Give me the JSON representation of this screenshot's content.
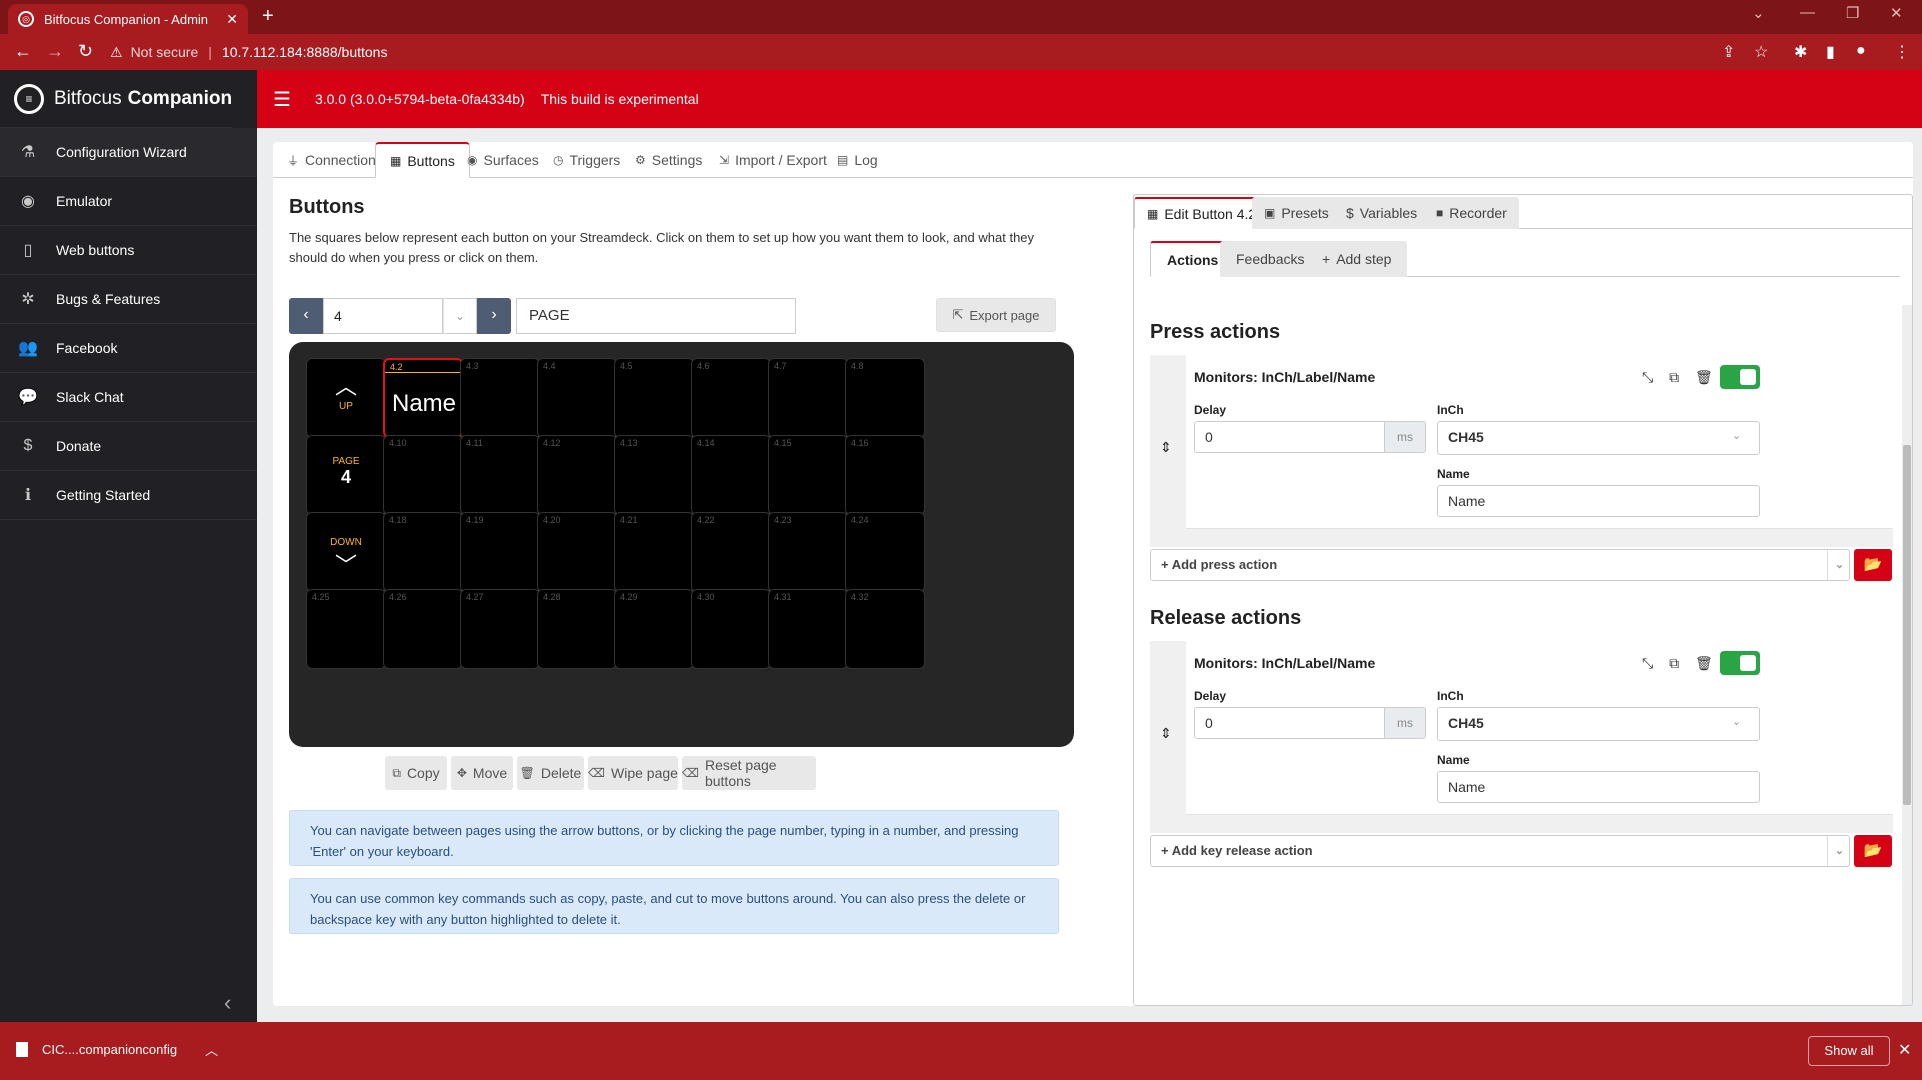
{
  "browser": {
    "tab_title": "Bitfocus Companion - Admin",
    "not_secure": "Not secure",
    "url": "10.7.112.184:8888/buttons"
  },
  "brand": {
    "name1": "Bitfocus",
    "name2": "Companion"
  },
  "header": {
    "version": "3.0.0 (3.0.0+5794-beta-0fa4334b)",
    "notice": "This build is experimental"
  },
  "sidebar": {
    "items": [
      {
        "label": "Configuration Wizard",
        "icon": "wand-icon"
      },
      {
        "label": "Emulator",
        "icon": "gamepad-icon"
      },
      {
        "label": "Web buttons",
        "icon": "tablet-icon"
      },
      {
        "label": "Bugs & Features",
        "icon": "bug-icon"
      },
      {
        "label": "Facebook",
        "icon": "users-icon"
      },
      {
        "label": "Slack Chat",
        "icon": "comments-icon"
      },
      {
        "label": "Donate",
        "icon": "dollar-icon"
      },
      {
        "label": "Getting Started",
        "icon": "info-icon"
      }
    ]
  },
  "tabs": [
    "Connections",
    "Buttons",
    "Surfaces",
    "Triggers",
    "Settings",
    "Import / Export",
    "Log"
  ],
  "buttons": {
    "title": "Buttons",
    "description": "The squares below represent each button on your Streamdeck. Click on them to set up how you want them to look, and what they should do when you press or click on them.",
    "page_number": "4",
    "page_name": "PAGE",
    "export_label": "Export page",
    "nav": {
      "up": "UP",
      "page": "PAGE",
      "page_num": "4",
      "down": "DOWN"
    },
    "selected_key": {
      "id": "4.2",
      "text": "Name"
    },
    "key_ids": [
      [
        "4.3",
        "4.4",
        "4.5",
        "4.6",
        "4.7",
        "4.8"
      ],
      [
        "4.10",
        "4.11",
        "4.12",
        "4.13",
        "4.14",
        "4.15",
        "4.16"
      ],
      [
        "4.18",
        "4.19",
        "4.20",
        "4.21",
        "4.22",
        "4.23",
        "4.24"
      ],
      [
        "4.25",
        "4.26",
        "4.27",
        "4.28",
        "4.29",
        "4.30",
        "4.31",
        "4.32"
      ]
    ],
    "toolbar": {
      "copy": "Copy",
      "move": "Move",
      "delete": "Delete",
      "wipe": "Wipe page",
      "reset": "Reset page buttons"
    },
    "info1": "You can navigate between pages using the arrow buttons, or by clicking the page number, typing in a number, and pressing 'Enter' on your keyboard.",
    "info2": "You can use common key commands such as copy, paste, and cut to move buttons around. You can also press the delete or backspace key with any button highlighted to delete it."
  },
  "editor": {
    "tabs": [
      "Edit Button 4.2",
      "Presets",
      "Variables",
      "Recorder"
    ],
    "subtabs": [
      "Actions",
      "Feedbacks",
      "Add step"
    ],
    "press_title": "Press actions",
    "release_title": "Release actions",
    "action": {
      "title": "Monitors: InCh/Label/Name",
      "delay_label": "Delay",
      "delay_value": "0",
      "delay_unit": "ms",
      "inch_label": "InCh",
      "inch_value": "CH45",
      "name_label": "Name",
      "name_value": "Name"
    },
    "add_press": "+ Add press action",
    "add_release": "+ Add key release action"
  },
  "download": {
    "file": "CIC....companionconfig",
    "show_all": "Show all"
  },
  "colors": {
    "brand_red": "#d50215",
    "sidebar": "#212125",
    "toggle_on": "#2aa546",
    "key_highlight": "#ffb21d"
  }
}
